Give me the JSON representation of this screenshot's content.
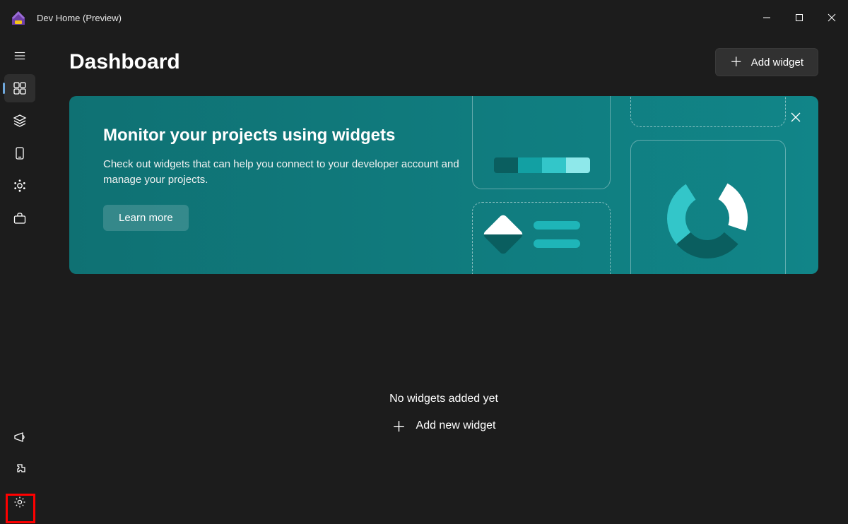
{
  "app": {
    "title": "Dev Home (Preview)"
  },
  "page": {
    "title": "Dashboard",
    "add_widget_label": "Add widget"
  },
  "banner": {
    "title": "Monitor your projects using widgets",
    "description": "Check out widgets that can help you connect to your developer account and manage your projects.",
    "learn_more_label": "Learn more"
  },
  "empty_state": {
    "title": "No widgets added yet",
    "add_label": "Add new widget"
  },
  "nav": {
    "items": [
      {
        "name": "hamburger"
      },
      {
        "name": "dashboard",
        "selected": true
      },
      {
        "name": "layers"
      },
      {
        "name": "device"
      },
      {
        "name": "connections"
      },
      {
        "name": "toolkit"
      }
    ],
    "bottom_items": [
      {
        "name": "feedback"
      },
      {
        "name": "extensions"
      },
      {
        "name": "settings",
        "highlighted": true
      }
    ]
  },
  "colors": {
    "background": "#1c1c1c",
    "banner": "#0f7173",
    "accent": "#1eb5b8",
    "highlight": "#ff0000"
  }
}
